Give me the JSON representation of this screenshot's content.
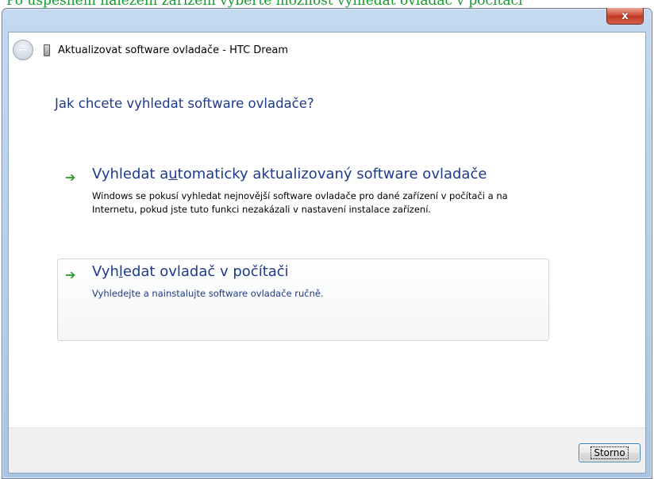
{
  "caption": {
    "text": "Po úspěšném nalezení zařízení vyberte možnost vyhledat ovladač v počítači"
  },
  "window": {
    "title": "Aktualizovat software ovladače - HTC Dream",
    "close_symbol": "x",
    "back_symbol": "←",
    "device_icon": "device-icon"
  },
  "main": {
    "heading": "Jak chcete vyhledat software ovladače?",
    "choices": [
      {
        "title_before": "Vyhledat a",
        "title_mnemonic": "u",
        "title_after": "tomaticky aktualizovaný software ovladače",
        "description": "Windows se pokusí vyhledat nejnovější software ovladače pro dané zařízení v počítači a na Internetu, pokud jste tuto funkci nezakázali v nastavení instalace zařízení.",
        "arrow": "➔"
      },
      {
        "title_before": "Vyh",
        "title_mnemonic": "l",
        "title_after": "edat ovladač v počítači",
        "description": "Vyhledejte a nainstalujte software ovladače ručně.",
        "arrow": "➔"
      }
    ]
  },
  "footer": {
    "cancel_label": "Storno"
  },
  "colors": {
    "link": "#1e3a8a",
    "arrow": "#2e9e2e",
    "caption": "#149a2b",
    "close": "#c03a22"
  }
}
